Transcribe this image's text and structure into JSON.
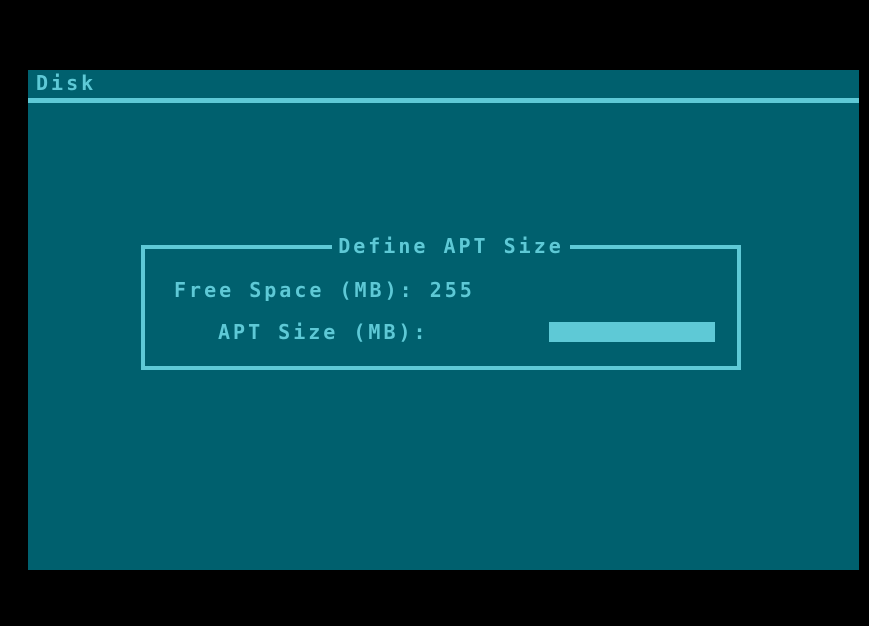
{
  "menu": {
    "title": "Disk"
  },
  "dialog": {
    "title": "Define APT Size",
    "free_space": {
      "label": "Free Space (MB):",
      "value": "255"
    },
    "apt_size": {
      "label": "APT Size (MB):",
      "value": ""
    }
  },
  "colors": {
    "background": "#00606e",
    "foreground": "#5ec9d6",
    "border": "#000000"
  }
}
